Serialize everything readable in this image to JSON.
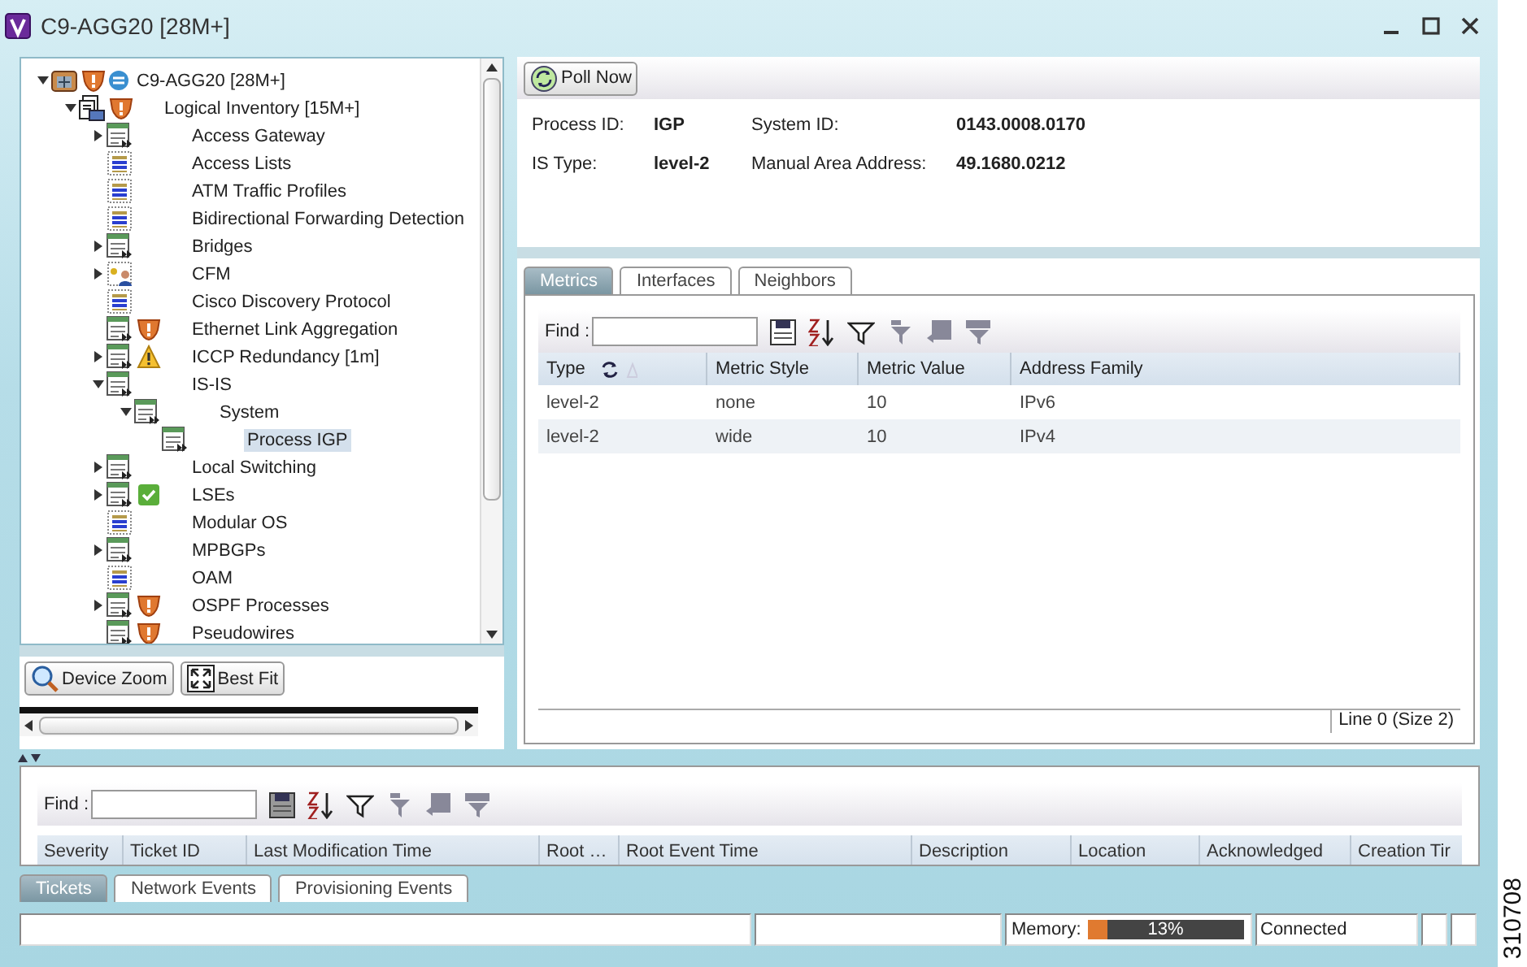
{
  "window": {
    "title": "C9-AGG20 [28M+]"
  },
  "tree": [
    {
      "label": "C9-AGG20 [28M+]",
      "kind": "device",
      "alerts": [
        {
          "kind": "major"
        },
        {
          "kind": "sync"
        }
      ],
      "expanded": true,
      "selected": false,
      "children": [
        {
          "label": "Logical Inventory [15M+]",
          "kind": "inventory",
          "alerts": [
            {
              "kind": "major"
            }
          ],
          "expanded": true,
          "selected": false,
          "children": [
            {
              "label": "Access Gateway",
              "kind": "table",
              "expanded": false,
              "selected": false
            },
            {
              "label": "Access Lists",
              "kind": "list",
              "selected": false
            },
            {
              "label": "ATM Traffic Profiles",
              "kind": "list",
              "selected": false
            },
            {
              "label": "Bidirectional Forwarding Detection",
              "kind": "list",
              "selected": false
            },
            {
              "label": "Bridges",
              "kind": "table",
              "expanded": false,
              "selected": false
            },
            {
              "label": "CFM",
              "kind": "cfm",
              "expanded": false,
              "selected": false
            },
            {
              "label": "Cisco Discovery Protocol",
              "kind": "list",
              "selected": false
            },
            {
              "label": "Ethernet Link Aggregation",
              "kind": "table",
              "alerts": [
                {
                  "kind": "major"
                }
              ],
              "selected": false
            },
            {
              "label": "ICCP Redundancy [1m]",
              "kind": "table",
              "alerts": [
                {
                  "kind": "warning"
                }
              ],
              "expanded": false,
              "selected": false
            },
            {
              "label": "IS-IS",
              "kind": "table",
              "expanded": true,
              "selected": false,
              "children": [
                {
                  "label": "System",
                  "kind": "table",
                  "expanded": true,
                  "selected": false,
                  "children": [
                    {
                      "label": "Process IGP",
                      "kind": "table",
                      "selected": true
                    }
                  ]
                }
              ]
            },
            {
              "label": "Local Switching",
              "kind": "table",
              "expanded": false,
              "selected": false
            },
            {
              "label": "LSEs",
              "kind": "table",
              "alerts": [
                {
                  "kind": "ok"
                }
              ],
              "expanded": false,
              "selected": false
            },
            {
              "label": "Modular OS",
              "kind": "list",
              "selected": false
            },
            {
              "label": "MPBGPs",
              "kind": "table",
              "expanded": false,
              "selected": false
            },
            {
              "label": "OAM",
              "kind": "list",
              "selected": false
            },
            {
              "label": "OSPF Processes",
              "kind": "table",
              "alerts": [
                {
                  "kind": "major"
                }
              ],
              "expanded": false,
              "selected": false
            },
            {
              "label": "Pseudowires",
              "kind": "table",
              "alerts": [
                {
                  "kind": "major"
                }
              ],
              "selected": false
            }
          ]
        }
      ]
    }
  ],
  "zoom_buttons": [
    {
      "label": "Device Zoom",
      "kind": "zoom"
    },
    {
      "label": "Best Fit",
      "kind": "fit"
    }
  ],
  "poll_button": {
    "label": "Poll Now"
  },
  "details": [
    {
      "label": "Process ID:",
      "value": "IGP"
    },
    {
      "label": "System ID:",
      "value": "0143.0008.0170"
    },
    {
      "label": "IS Type:",
      "value": "level-2"
    },
    {
      "label": "Manual Area Address:",
      "value": "49.1680.0212"
    }
  ],
  "detail_tabs": [
    {
      "label": "Metrics",
      "selected": true
    },
    {
      "label": "Interfaces",
      "selected": false
    },
    {
      "label": "Neighbors",
      "selected": false
    }
  ],
  "metrics": {
    "find_label": "Find :",
    "columns": [
      {
        "label": "Type",
        "sorted": true
      },
      {
        "label": "Metric Style",
        "sorted": false
      },
      {
        "label": "Metric Value",
        "sorted": false
      },
      {
        "label": "Address Family",
        "sorted": false
      }
    ],
    "rows": [
      [
        "level-2",
        "none",
        "10",
        "IPv6"
      ],
      [
        "level-2",
        "wide",
        "10",
        "IPv4"
      ]
    ],
    "footer": "Line 0 (Size 2)"
  },
  "events": {
    "find_label": "Find :",
    "columns": [
      "Severity",
      "Ticket ID",
      "Last Modification Time",
      "Root …",
      "Root Event Time",
      "Description",
      "Location",
      "Acknowledged",
      "Creation Tir"
    ]
  },
  "event_tabs": [
    {
      "label": "Tickets",
      "selected": true
    },
    {
      "label": "Network Events",
      "selected": false
    },
    {
      "label": "Provisioning Events",
      "selected": false
    }
  ],
  "status_bar": {
    "memory_label": "Memory:",
    "memory": {
      "level": 0.13,
      "reading": "13%"
    },
    "connection": "Connected"
  },
  "figure_id": "310708"
}
